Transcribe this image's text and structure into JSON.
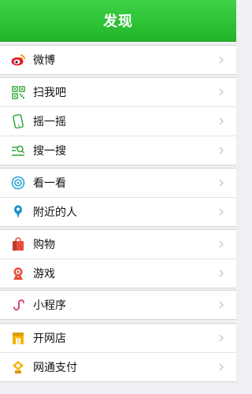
{
  "header": {
    "title": "发现"
  },
  "colors": {
    "accent": "#22b52b",
    "background": "#efeff4"
  },
  "menu": {
    "weibo": {
      "label": "微博",
      "icon": "weibo-icon"
    },
    "scan": {
      "label": "扫我吧",
      "icon": "qr-scan-icon"
    },
    "shake": {
      "label": "摇一摇",
      "icon": "phone-shake-icon"
    },
    "search": {
      "label": "搜一搜",
      "icon": "search-icon"
    },
    "look": {
      "label": "看一看",
      "icon": "eye-icon"
    },
    "nearby": {
      "label": "附近的人",
      "icon": "location-pin-icon"
    },
    "shopping": {
      "label": "购物",
      "icon": "shopping-bag-icon"
    },
    "games": {
      "label": "游戏",
      "icon": "game-icon"
    },
    "miniprogram": {
      "label": "小程序",
      "icon": "miniprogram-icon"
    },
    "openshop": {
      "label": "开网店",
      "icon": "shop-icon"
    },
    "pay": {
      "label": "网通支付",
      "icon": "payment-icon"
    }
  }
}
